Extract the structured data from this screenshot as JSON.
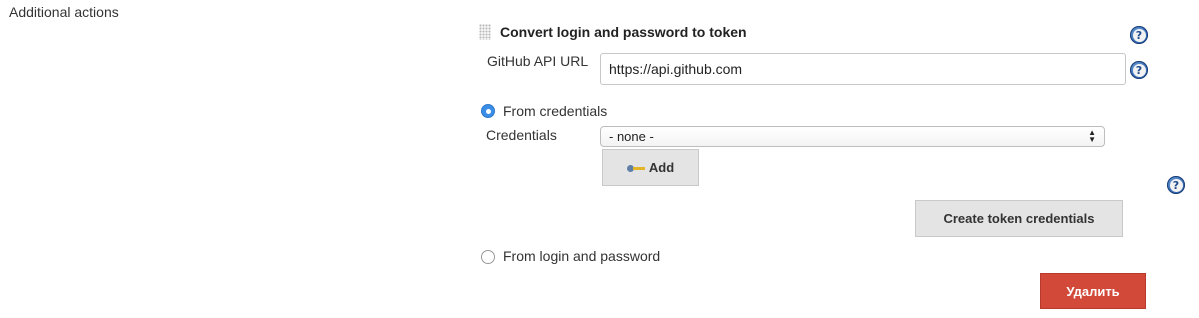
{
  "section": {
    "label": "Additional actions"
  },
  "block": {
    "title": "Convert login and password to token",
    "icons": {
      "drag": "drag-handle-icon",
      "help": "help-icon",
      "key": "key-icon",
      "select_arrows": "updown-arrows-icon"
    }
  },
  "fields": {
    "github_api_url": {
      "label": "GitHub API URL",
      "value": "https://api.github.com"
    },
    "credentials": {
      "label": "Credentials",
      "selected": "- none -"
    }
  },
  "radios": {
    "from_credentials": {
      "label": "From credentials",
      "checked": true
    },
    "from_login": {
      "label": "From login and password",
      "checked": false
    }
  },
  "buttons": {
    "add": "Add",
    "create_token": "Create token credentials",
    "delete": "Удалить"
  },
  "colors": {
    "radio_selected": "#3b8ee8",
    "delete_button": "#d24939",
    "help_icon": "#2e64b0"
  }
}
